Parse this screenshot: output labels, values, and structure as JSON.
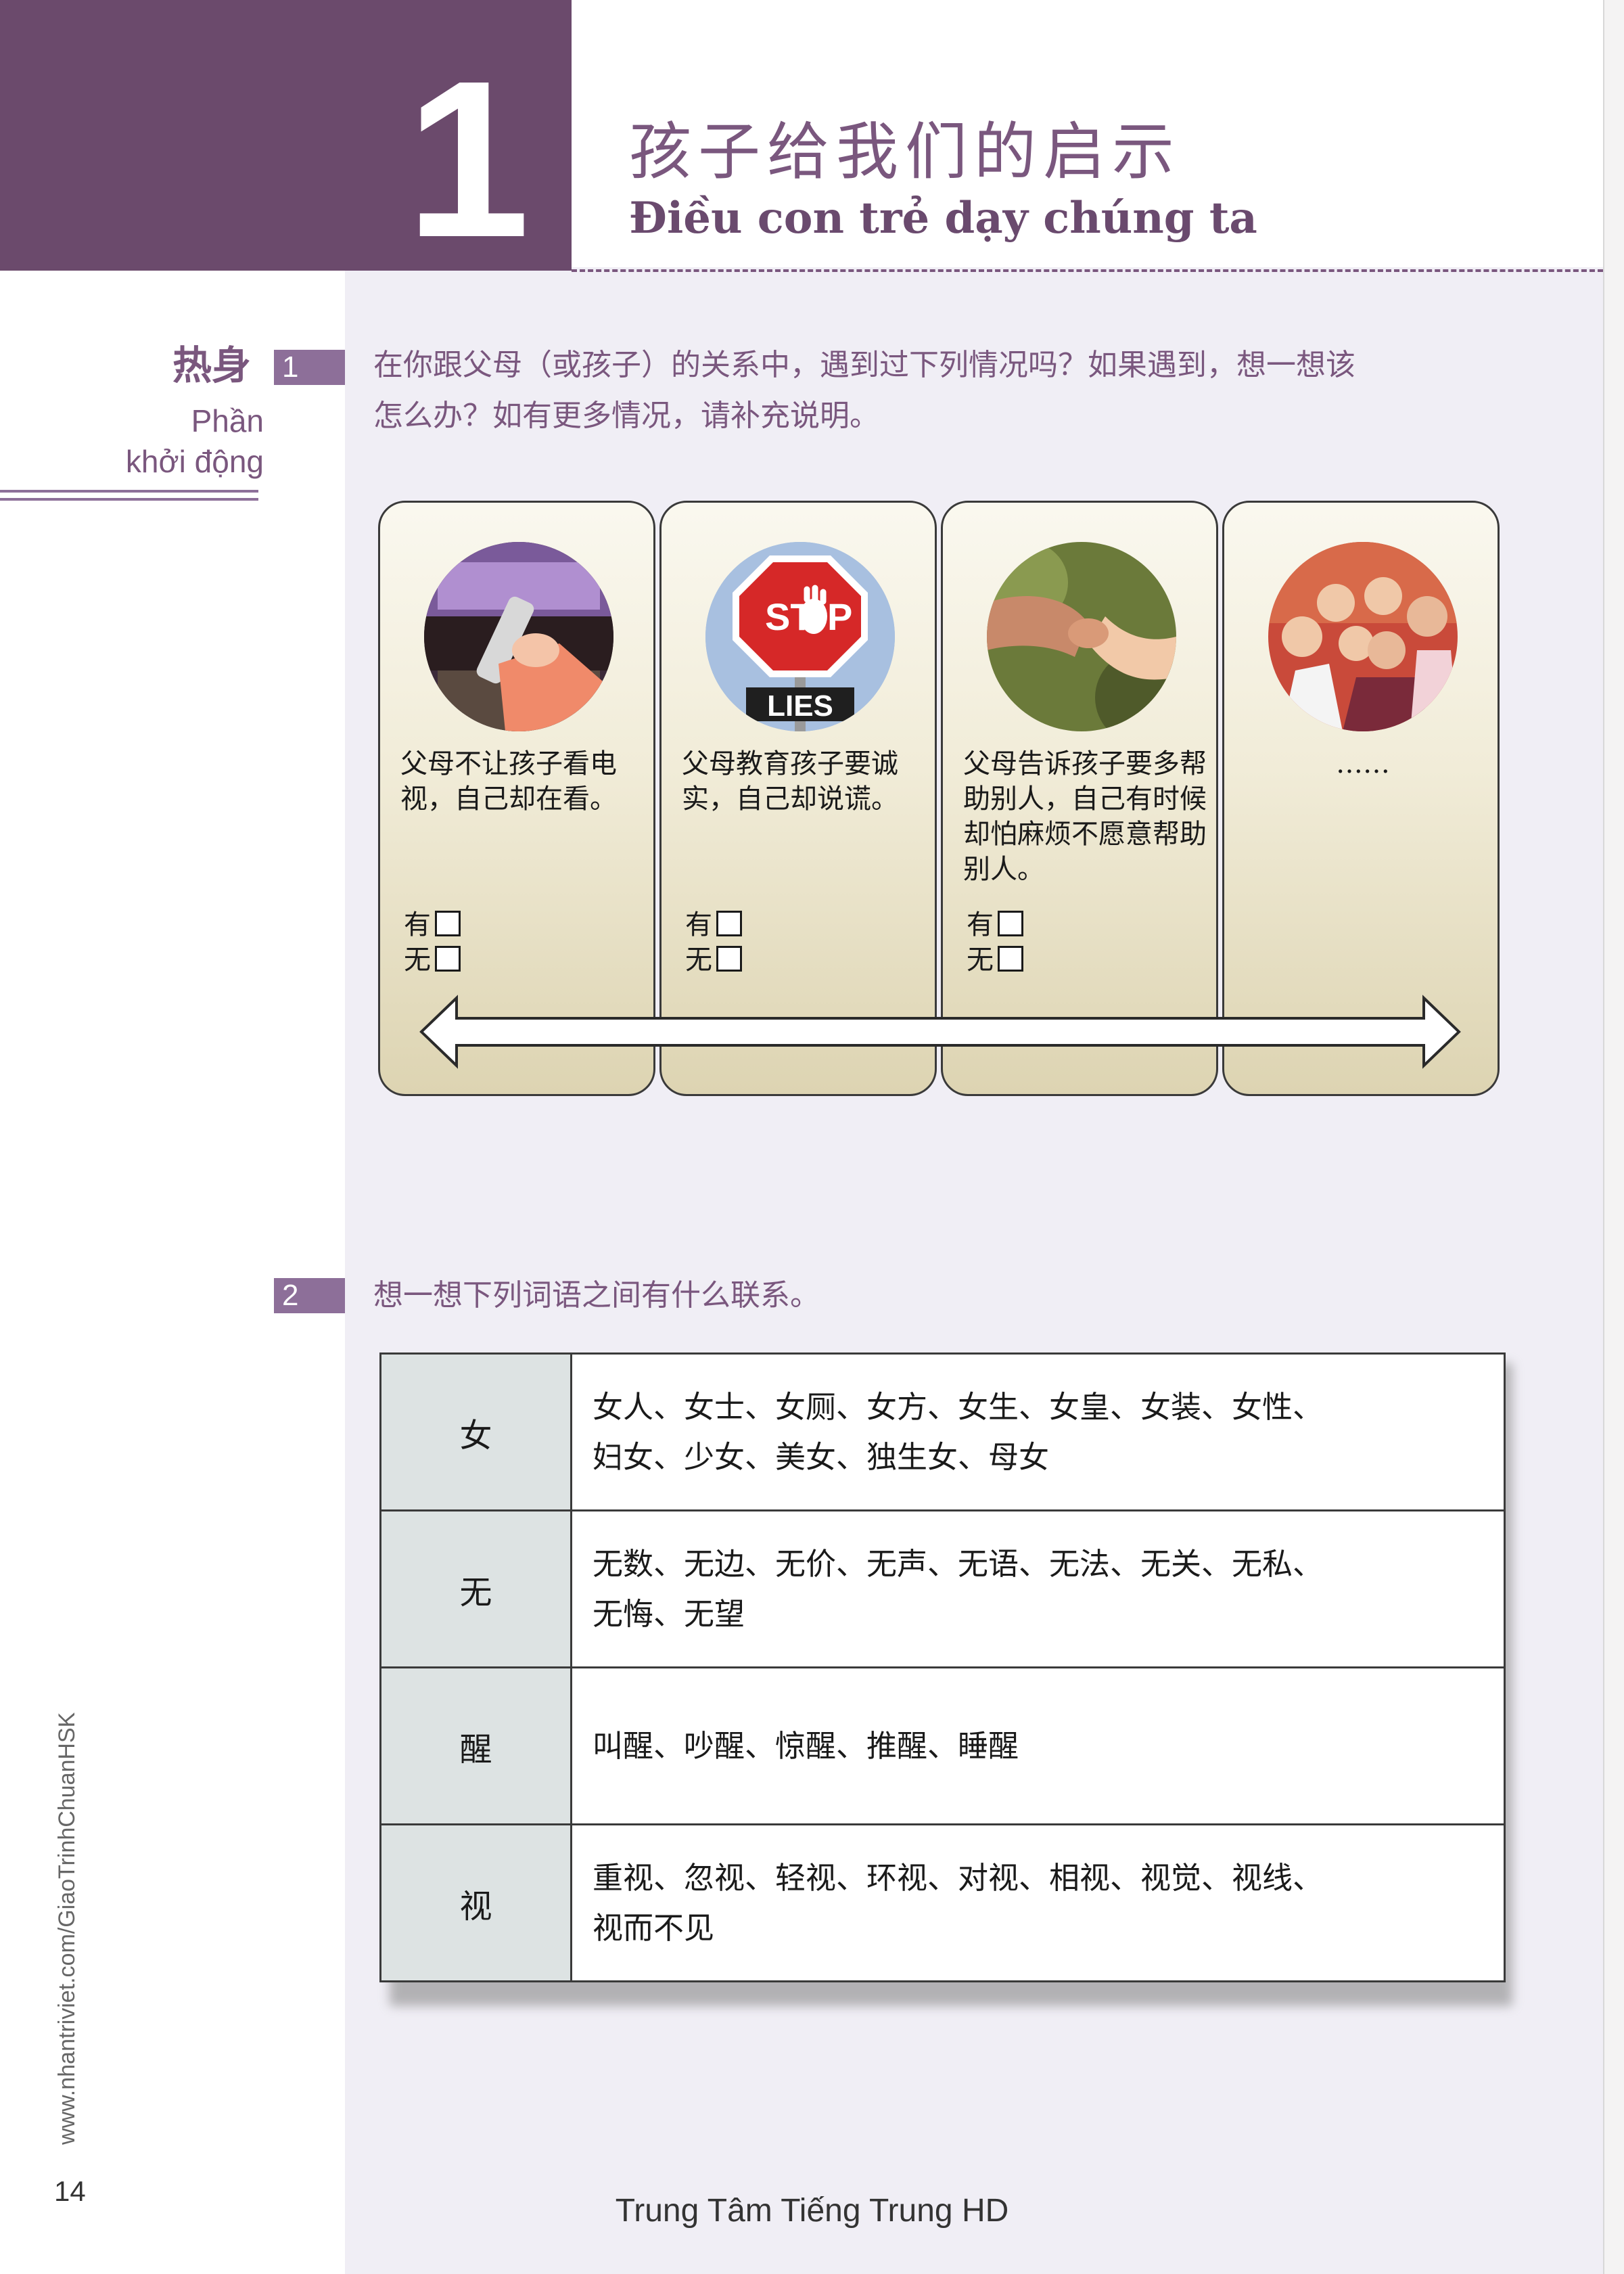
{
  "header": {
    "lesson_number": "1",
    "title_zh": "孩子给我们的启示",
    "title_vi": "Điều con trẻ dạy chúng ta",
    "accent_color": "#6b4a6c"
  },
  "section": {
    "label_zh": "热身",
    "label_vi_line1": "Phần",
    "label_vi_line2": "khởi động"
  },
  "exercise1": {
    "number": "1",
    "instruction_line1": "在你跟父母（或孩子）的关系中，遇到过下列情况吗？如果遇到，想一想该",
    "instruction_line2": "怎么办？如有更多情况，请补充说明。",
    "cards": [
      {
        "text": "父母不让孩子看电视，自己却在看。",
        "yes": "有",
        "no": "无",
        "image": "tv-remote-photo"
      },
      {
        "text": "父母教育孩子要诚实，自己却说谎。",
        "yes": "有",
        "no": "无",
        "image": "stop-lies-sign-photo",
        "sign_text_top": "ST",
        "sign_text_bottom": "P",
        "lies_label": "LIES"
      },
      {
        "text": "父母告诉孩子要多帮助别人，自己有时候却怕麻烦不愿意帮助别人。",
        "yes": "有",
        "no": "无",
        "image": "holding-hands-photo"
      },
      {
        "text": "……",
        "image": "family-photo"
      }
    ]
  },
  "exercise2": {
    "number": "2",
    "instruction": "想一想下列词语之间有什么联系。",
    "rows": [
      {
        "key": "女",
        "line1": "女人、女士、女厕、女方、女生、女皇、女装、女性、",
        "line2": "妇女、少女、美女、独生女、母女"
      },
      {
        "key": "无",
        "line1": "无数、无边、无价、无声、无语、无法、无关、无私、",
        "line2": "无悔、无望"
      },
      {
        "key": "醒",
        "line1": "叫醒、吵醒、惊醒、推醒、睡醒",
        "line2": ""
      },
      {
        "key": "视",
        "line1": "重视、忽视、轻视、环视、对视、相视、视觉、视线、",
        "line2": "视而不见"
      }
    ]
  },
  "footer": {
    "page_number": "14",
    "side_url": "www.nhantriviet.com/GiaoTrinhChuanHSK",
    "center_text": "Trung Tâm Tiếng Trung HD"
  }
}
